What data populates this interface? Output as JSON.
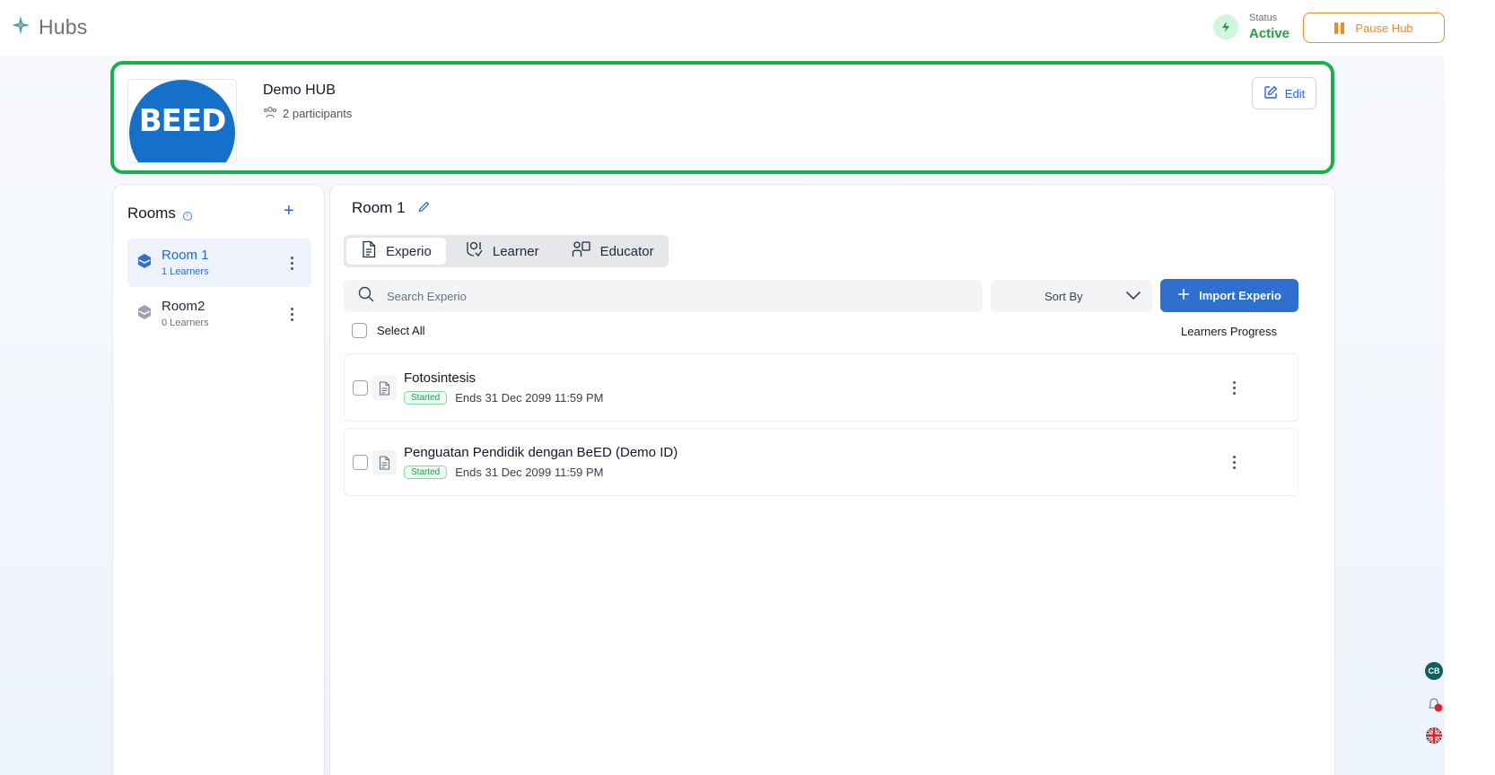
{
  "app": {
    "title": "Hubs"
  },
  "header": {
    "status_label": "Status",
    "status_value": "Active",
    "pause_label": "Pause Hub"
  },
  "hub": {
    "logo_text": "BEED",
    "name": "Demo HUB",
    "participants": "2 participants",
    "edit_label": "Edit"
  },
  "rooms": {
    "title": "Rooms",
    "items": [
      {
        "name": "Room 1",
        "learners": "1 Learners",
        "active": true
      },
      {
        "name": "Room2",
        "learners": "0 Learners",
        "active": false
      }
    ]
  },
  "main": {
    "room_title": "Room 1",
    "tabs": [
      {
        "label": "Experio",
        "active": true
      },
      {
        "label": "Learner",
        "active": false
      },
      {
        "label": "Educator",
        "active": false
      }
    ],
    "search_placeholder": "Search Experio",
    "sort_label": "Sort By",
    "import_label": "Import Experio",
    "select_all_label": "Select All",
    "progress_label": "Learners Progress",
    "experios": [
      {
        "title": "Fotosintesis",
        "status": "Started",
        "ends": "Ends 31 Dec 2099 11:59 PM"
      },
      {
        "title": "Penguatan Pendidik dengan BeED (Demo ID)",
        "status": "Started",
        "ends": "Ends 31 Dec 2099 11:59 PM"
      }
    ]
  },
  "side": {
    "avatar_initials": "CB"
  },
  "colors": {
    "accent_blue": "#2f6fd0",
    "status_green": "#22a045",
    "highlight_green": "#16b14b",
    "pause_orange": "#f08a1e",
    "logo_blue": "#1570c9"
  }
}
